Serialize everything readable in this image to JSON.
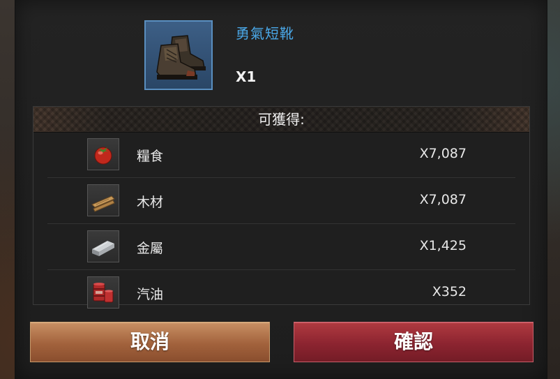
{
  "item": {
    "name": "勇氣短靴",
    "quantity": "X1",
    "icon": "boots-icon"
  },
  "rewards": {
    "header": "可獲得:",
    "items": [
      {
        "label": "糧食",
        "amount": "X7,087",
        "icon": "tomato-food-icon"
      },
      {
        "label": "木材",
        "amount": "X7,087",
        "icon": "wood-planks-icon"
      },
      {
        "label": "金屬",
        "amount": "X1,425",
        "icon": "metal-ingot-icon"
      },
      {
        "label": "汽油",
        "amount": "X352",
        "icon": "gasoline-barrel-icon"
      }
    ]
  },
  "buttons": {
    "cancel": "取消",
    "confirm": "確認"
  },
  "colors": {
    "item_name": "#4aa8e8",
    "cancel_button": "#a2623c",
    "confirm_button": "#8c2430",
    "item_frame": "#3d5f86"
  }
}
